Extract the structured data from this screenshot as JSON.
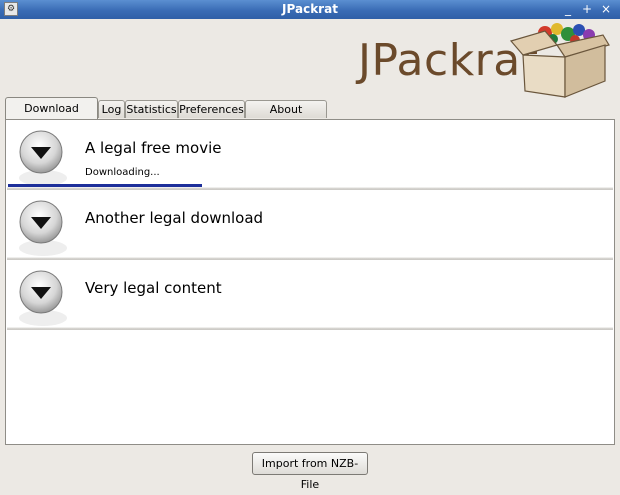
{
  "window": {
    "title": "JPackrat",
    "controls": {
      "minimize": "_",
      "maximize": "+",
      "close": "×"
    }
  },
  "header": {
    "logo_text": "JPackrat"
  },
  "tabs": [
    {
      "label": "Download Queue",
      "active": true
    },
    {
      "label": "Log",
      "active": false
    },
    {
      "label": "Statistics",
      "active": false
    },
    {
      "label": "Preferences",
      "active": false
    },
    {
      "label": "About JPackrat",
      "active": false
    }
  ],
  "queue": [
    {
      "title": "A legal free movie",
      "status": "Downloading...",
      "progress": 0.32,
      "icon": "download-arrow-icon"
    },
    {
      "title": "Another legal download",
      "status": "",
      "icon": "download-arrow-icon"
    },
    {
      "title": "Very legal content",
      "status": "",
      "icon": "download-arrow-icon"
    }
  ],
  "footer": {
    "import_label": "Import from NZB-File"
  },
  "colors": {
    "titlebar": "#3a6cb5",
    "logo": "#6b4a2b",
    "progress": "#1d2f9a",
    "background": "#ece9e4"
  }
}
